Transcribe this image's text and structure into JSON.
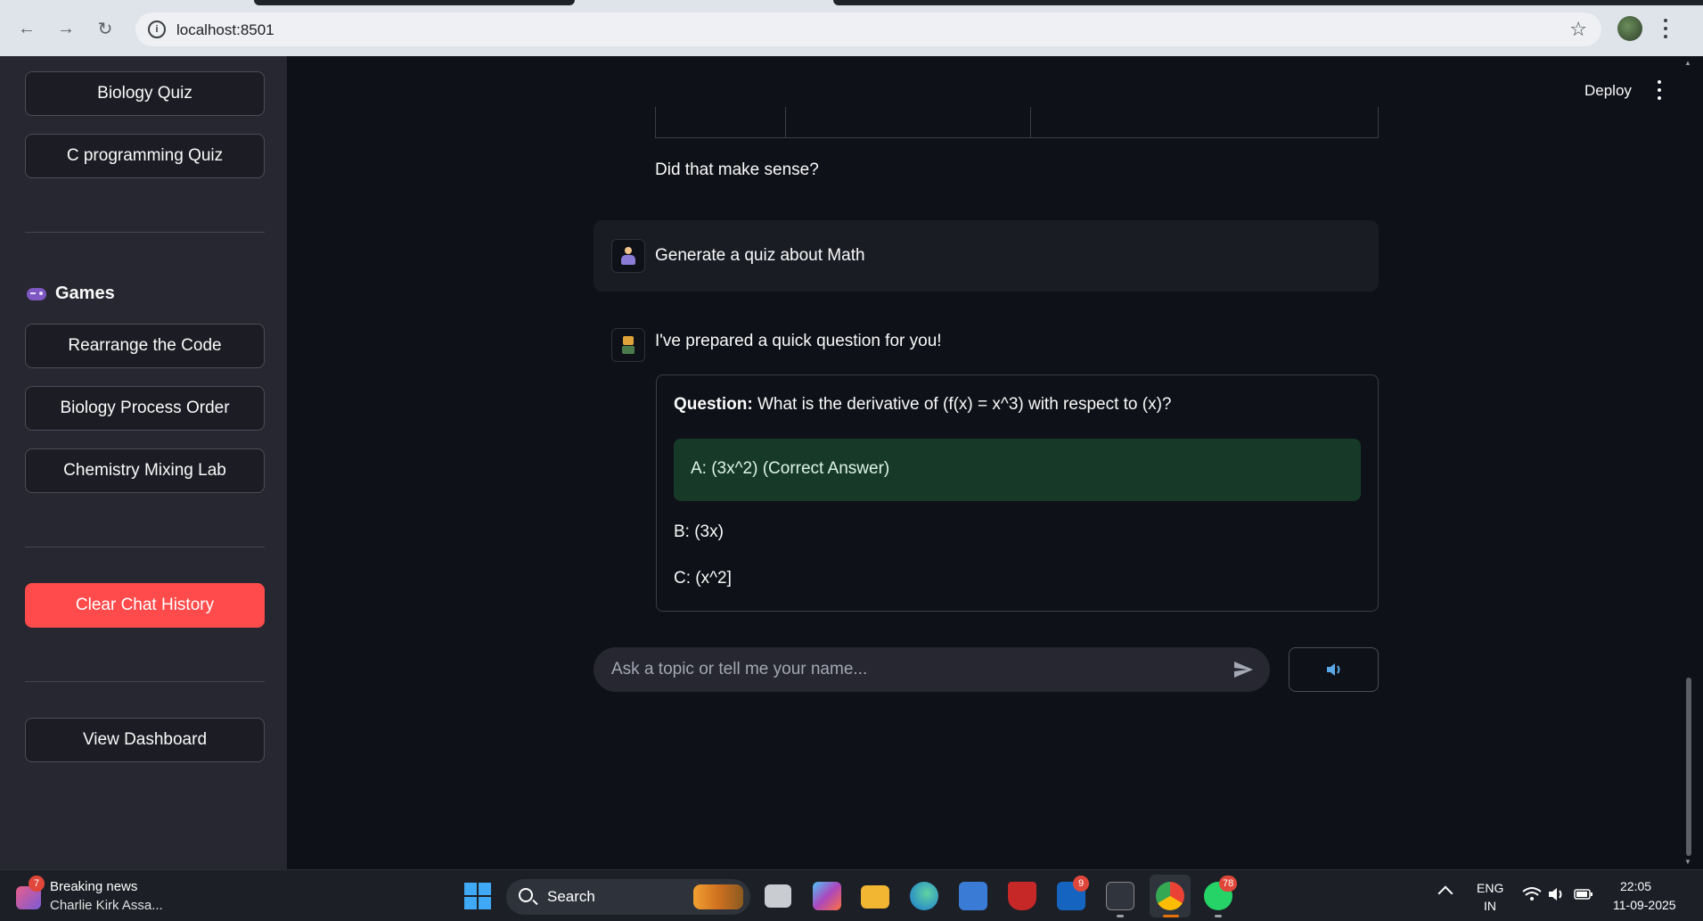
{
  "browser": {
    "url": "localhost:8501"
  },
  "sidebar": {
    "quiz_buttons": [
      "Biology Quiz",
      "C programming Quiz"
    ],
    "games_heading": "Games",
    "game_buttons": [
      "Rearrange the Code",
      "Biology Process Order",
      "Chemistry Mixing Lab"
    ],
    "clear_button": "Clear Chat History",
    "dashboard_button": "View Dashboard"
  },
  "header": {
    "deploy_label": "Deploy"
  },
  "chat": {
    "prev_assistant_text": "Did that make sense?",
    "user_message": "Generate a quiz about Math",
    "assistant_intro": "I've prepared a quick question for you!",
    "quiz": {
      "question_label": "Question:",
      "question_text": " What is the derivative of (f(x) = x^3) with respect to (x)?",
      "correct_option": "A: (3x^2) (Correct Answer)",
      "option_b": "B: (3x)",
      "option_c": "C: (x^2]"
    },
    "input_placeholder": "Ask a topic or tell me your name..."
  },
  "taskbar": {
    "news_badge": "7",
    "news_title": "Breaking news",
    "news_subtitle": "Charlie Kirk Assa...",
    "search_label": "Search",
    "l_app_badge": "9",
    "whatsapp_badge": "78",
    "lang_line1": "ENG",
    "lang_line2": "IN",
    "time": "22:05",
    "date": "11-09-2025"
  },
  "colors": {
    "app_bg": "#0e1117",
    "sidebar_bg": "#262730",
    "danger": "#ff4b4b",
    "correct_bg": "#173928"
  }
}
